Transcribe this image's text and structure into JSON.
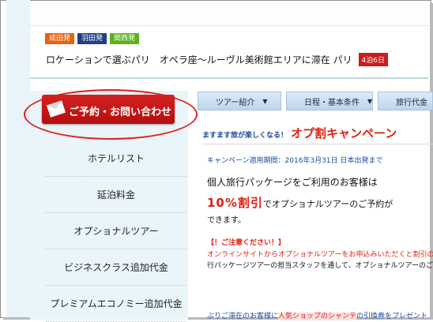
{
  "badges": [
    {
      "label": "成田発",
      "color": "#e8630f"
    },
    {
      "label": "羽田発",
      "color": "#1f3f8a"
    },
    {
      "label": "関西発",
      "color": "#5db11f"
    }
  ],
  "headline": "ロケーションで選ぶパリ　オペラ座～ルーヴル美術館エリアに滞在 パリ",
  "day_badge": "4泊6日",
  "cta": {
    "label": "ご予約・お問い合わせ"
  },
  "sidebar_items": [
    "ホテルリスト",
    "延泊料金",
    "オプショナルツアー",
    "ビジネスクラス追加代金",
    "プレミアムエコノミー追加代金"
  ],
  "nav": [
    {
      "label": "ツアー紹介"
    },
    {
      "label": "日程・基本条件"
    },
    {
      "label": "旅行代金"
    }
  ],
  "campaign": {
    "pre": "ますます旅が楽しくなる！",
    "title": "オプ割キャンペーン",
    "period": "キャンペーン適用期間：2016年3月31日 日本出発まで",
    "line1": "個人旅行パッケージをご利用のお客様は",
    "discount": "10%割引",
    "discount_suffix": "でオプショナルツアーのご予約が",
    "possible": "できます。",
    "notice_title": "【！ご注意ください！】",
    "notice1": "オンラインサイトからオプショナルツアーをお申込みいただくと割引の適用",
    "notice2": "行パッケージツアーの担当スタッフを通して、オプショナルツアーのご予約",
    "bottom_pre": "ぶりご滞在のお客様に",
    "bottom_hl": "人気ショップのシャンテ",
    "bottom_post": "の引換券をプレゼント"
  }
}
